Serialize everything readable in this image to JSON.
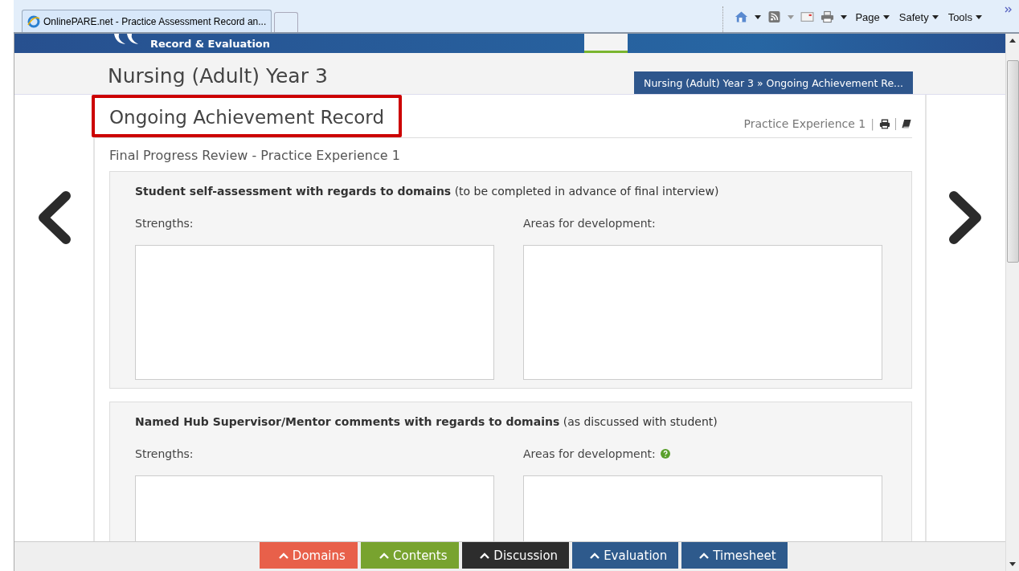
{
  "browser": {
    "tab_title": "OnlinePARE.net - Practice Assessment Record an...",
    "commands": [
      {
        "label": "Page"
      },
      {
        "label": "Safety"
      },
      {
        "label": "Tools"
      }
    ]
  },
  "site_header": {
    "brand": "Record & Evaluation"
  },
  "course": {
    "title": "Nursing (Adult) Year 3",
    "breadcrumb": "Nursing (Adult) Year 3 » Ongoing Achievement Re..."
  },
  "page": {
    "title": "Ongoing Achievement Record",
    "highlighted": true,
    "experience": "Practice Experience 1",
    "separator": "|",
    "subtitle": "Final Progress Review - Practice Experience 1"
  },
  "sections": [
    {
      "heading": "**Student self-assessment with regards to domains** (to be completed in advance of final interview)",
      "fields": [
        {
          "label": "Strengths:",
          "help": false
        },
        {
          "label": "Areas for development:",
          "help": false
        }
      ]
    },
    {
      "heading": "**Named Hub Supervisor/Mentor comments with regards to domains** (as discussed with student)",
      "fields": [
        {
          "label": "Strengths:",
          "help": false
        },
        {
          "label": "Areas for development:",
          "help": true
        }
      ]
    }
  ],
  "bottom_tabs": [
    {
      "label": "Domains",
      "color": "#e8604a"
    },
    {
      "label": "Contents",
      "color": "#78a32f"
    },
    {
      "label": "Discussion",
      "color": "#2d2d2d"
    },
    {
      "label": "Evaluation",
      "color": "#2e5a8c"
    },
    {
      "label": "Timesheet",
      "color": "#2e5a8c"
    }
  ]
}
